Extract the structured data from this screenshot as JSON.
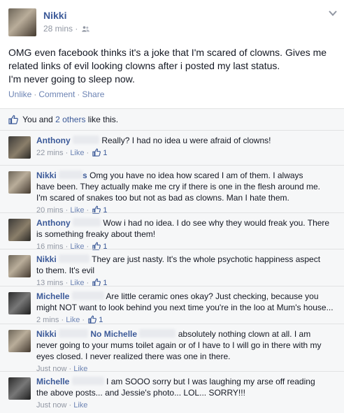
{
  "post": {
    "author": "Nikki",
    "time": "28 mins",
    "text_lines": [
      "OMG even facebook thinks it's a joke that I'm scared of clowns. Gives me",
      "related links of evil looking clowns after i posted my last status.",
      "I'm never going to sleep now."
    ],
    "actions": {
      "unlike": "Unlike",
      "comment": "Comment",
      "share": "Share",
      "separator": "·"
    }
  },
  "likes": {
    "you_and": "You and",
    "others": "2 others",
    "suffix": "like this."
  },
  "comments": [
    {
      "author": "Anthony",
      "lines": [
        "Really? I had no idea u were afraid of clowns!"
      ],
      "time": "22 mins",
      "like_label": "Like",
      "like_count": "1"
    },
    {
      "author": "Nikki",
      "name_tail": "s",
      "lines": [
        "Omg you have no idea how scared I am of them. I always",
        "have been. They actually make me cry if there is one in the flesh around me.",
        "I'm scared of snakes too but not as bad as clowns. Man I hate them."
      ],
      "time": "20 mins",
      "like_label": "Like",
      "like_count": "1"
    },
    {
      "author": "Anthony",
      "lines": [
        "Wow i had no idea. I do see why they would freak you. There",
        "is something freaky about them!"
      ],
      "time": "16 mins",
      "like_label": "Like",
      "like_count": "1"
    },
    {
      "author": "Nikki",
      "lines": [
        "They are just nasty. It's the whole psychotic happiness aspect",
        "to them. It's evil"
      ],
      "time": "13 mins",
      "like_label": "Like",
      "like_count": "1"
    },
    {
      "author": "Michelle",
      "lines": [
        "Are little ceramic ones okay? Just checking, because you",
        "might NOT want to look behind you next time you're in the loo at Mum's house..."
      ],
      "time": "2 mins",
      "like_label": "Like",
      "like_count": "1"
    },
    {
      "author": "Nikki",
      "tag": "No Michelle",
      "lines": [
        "absolutely nothing clown at all. I am",
        "never going to your mums toilet again or of I have to I will go in there with my",
        "eyes closed. I never realized there was one in there."
      ],
      "time": "Just now",
      "like_label": "Like"
    },
    {
      "author": "Michelle",
      "lines": [
        "I am SOOO sorry but I was laughing my arse off reading",
        "the above posts... and Jessie's photo... LOL... SORRY!!!"
      ],
      "time": "Just now",
      "like_label": "Like"
    }
  ],
  "icons": {
    "audience": "friends-icon",
    "menu": "chevron-down-icon",
    "like": "thumbs-up-icon"
  },
  "colors": {
    "link": "#3b5998",
    "meta": "#9197a3",
    "ufi_bg": "#f6f7f8"
  }
}
